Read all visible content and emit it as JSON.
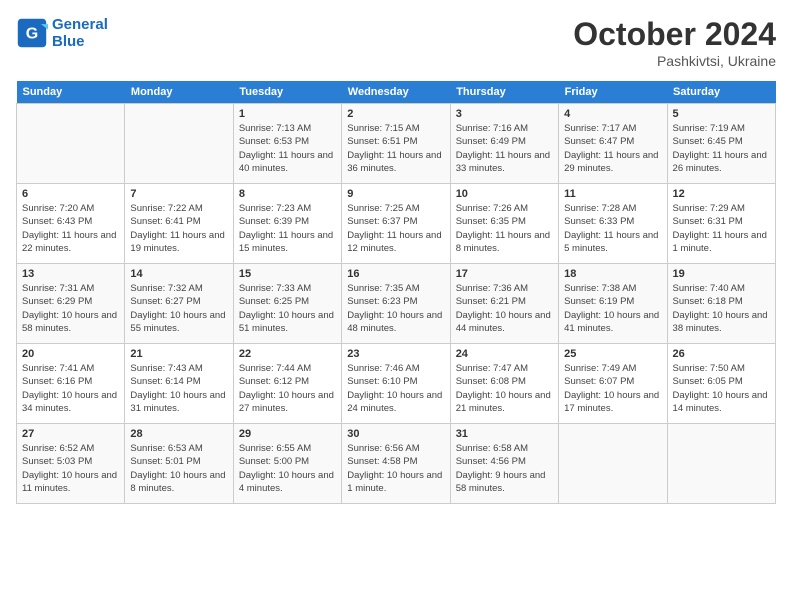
{
  "header": {
    "logo_line1": "General",
    "logo_line2": "Blue",
    "month": "October 2024",
    "location": "Pashkivtsi, Ukraine"
  },
  "days_of_week": [
    "Sunday",
    "Monday",
    "Tuesday",
    "Wednesday",
    "Thursday",
    "Friday",
    "Saturday"
  ],
  "weeks": [
    [
      {
        "num": "",
        "info": ""
      },
      {
        "num": "",
        "info": ""
      },
      {
        "num": "1",
        "info": "Sunrise: 7:13 AM\nSunset: 6:53 PM\nDaylight: 11 hours and 40 minutes."
      },
      {
        "num": "2",
        "info": "Sunrise: 7:15 AM\nSunset: 6:51 PM\nDaylight: 11 hours and 36 minutes."
      },
      {
        "num": "3",
        "info": "Sunrise: 7:16 AM\nSunset: 6:49 PM\nDaylight: 11 hours and 33 minutes."
      },
      {
        "num": "4",
        "info": "Sunrise: 7:17 AM\nSunset: 6:47 PM\nDaylight: 11 hours and 29 minutes."
      },
      {
        "num": "5",
        "info": "Sunrise: 7:19 AM\nSunset: 6:45 PM\nDaylight: 11 hours and 26 minutes."
      }
    ],
    [
      {
        "num": "6",
        "info": "Sunrise: 7:20 AM\nSunset: 6:43 PM\nDaylight: 11 hours and 22 minutes."
      },
      {
        "num": "7",
        "info": "Sunrise: 7:22 AM\nSunset: 6:41 PM\nDaylight: 11 hours and 19 minutes."
      },
      {
        "num": "8",
        "info": "Sunrise: 7:23 AM\nSunset: 6:39 PM\nDaylight: 11 hours and 15 minutes."
      },
      {
        "num": "9",
        "info": "Sunrise: 7:25 AM\nSunset: 6:37 PM\nDaylight: 11 hours and 12 minutes."
      },
      {
        "num": "10",
        "info": "Sunrise: 7:26 AM\nSunset: 6:35 PM\nDaylight: 11 hours and 8 minutes."
      },
      {
        "num": "11",
        "info": "Sunrise: 7:28 AM\nSunset: 6:33 PM\nDaylight: 11 hours and 5 minutes."
      },
      {
        "num": "12",
        "info": "Sunrise: 7:29 AM\nSunset: 6:31 PM\nDaylight: 11 hours and 1 minute."
      }
    ],
    [
      {
        "num": "13",
        "info": "Sunrise: 7:31 AM\nSunset: 6:29 PM\nDaylight: 10 hours and 58 minutes."
      },
      {
        "num": "14",
        "info": "Sunrise: 7:32 AM\nSunset: 6:27 PM\nDaylight: 10 hours and 55 minutes."
      },
      {
        "num": "15",
        "info": "Sunrise: 7:33 AM\nSunset: 6:25 PM\nDaylight: 10 hours and 51 minutes."
      },
      {
        "num": "16",
        "info": "Sunrise: 7:35 AM\nSunset: 6:23 PM\nDaylight: 10 hours and 48 minutes."
      },
      {
        "num": "17",
        "info": "Sunrise: 7:36 AM\nSunset: 6:21 PM\nDaylight: 10 hours and 44 minutes."
      },
      {
        "num": "18",
        "info": "Sunrise: 7:38 AM\nSunset: 6:19 PM\nDaylight: 10 hours and 41 minutes."
      },
      {
        "num": "19",
        "info": "Sunrise: 7:40 AM\nSunset: 6:18 PM\nDaylight: 10 hours and 38 minutes."
      }
    ],
    [
      {
        "num": "20",
        "info": "Sunrise: 7:41 AM\nSunset: 6:16 PM\nDaylight: 10 hours and 34 minutes."
      },
      {
        "num": "21",
        "info": "Sunrise: 7:43 AM\nSunset: 6:14 PM\nDaylight: 10 hours and 31 minutes."
      },
      {
        "num": "22",
        "info": "Sunrise: 7:44 AM\nSunset: 6:12 PM\nDaylight: 10 hours and 27 minutes."
      },
      {
        "num": "23",
        "info": "Sunrise: 7:46 AM\nSunset: 6:10 PM\nDaylight: 10 hours and 24 minutes."
      },
      {
        "num": "24",
        "info": "Sunrise: 7:47 AM\nSunset: 6:08 PM\nDaylight: 10 hours and 21 minutes."
      },
      {
        "num": "25",
        "info": "Sunrise: 7:49 AM\nSunset: 6:07 PM\nDaylight: 10 hours and 17 minutes."
      },
      {
        "num": "26",
        "info": "Sunrise: 7:50 AM\nSunset: 6:05 PM\nDaylight: 10 hours and 14 minutes."
      }
    ],
    [
      {
        "num": "27",
        "info": "Sunrise: 6:52 AM\nSunset: 5:03 PM\nDaylight: 10 hours and 11 minutes."
      },
      {
        "num": "28",
        "info": "Sunrise: 6:53 AM\nSunset: 5:01 PM\nDaylight: 10 hours and 8 minutes."
      },
      {
        "num": "29",
        "info": "Sunrise: 6:55 AM\nSunset: 5:00 PM\nDaylight: 10 hours and 4 minutes."
      },
      {
        "num": "30",
        "info": "Sunrise: 6:56 AM\nSunset: 4:58 PM\nDaylight: 10 hours and 1 minute."
      },
      {
        "num": "31",
        "info": "Sunrise: 6:58 AM\nSunset: 4:56 PM\nDaylight: 9 hours and 58 minutes."
      },
      {
        "num": "",
        "info": ""
      },
      {
        "num": "",
        "info": ""
      }
    ]
  ]
}
